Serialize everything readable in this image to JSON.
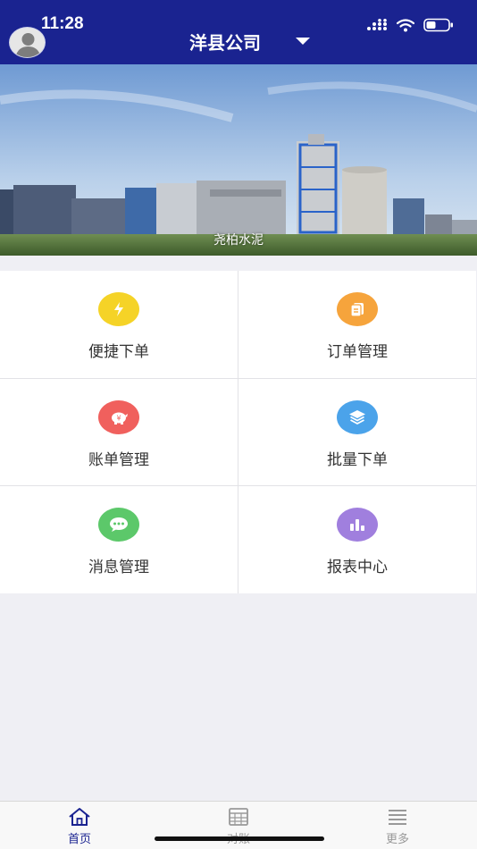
{
  "status_bar": {
    "time": "11:28"
  },
  "header": {
    "title": "洋县公司"
  },
  "banner": {
    "caption": "尧柏水泥"
  },
  "menu": {
    "items": [
      {
        "label": "便捷下单",
        "icon": "lightning-icon",
        "color": "#f5d327"
      },
      {
        "label": "订单管理",
        "icon": "document-icon",
        "color": "#f6a43c"
      },
      {
        "label": "账单管理",
        "icon": "piggy-bank-icon",
        "color": "#f0605d"
      },
      {
        "label": "批量下单",
        "icon": "layers-icon",
        "color": "#4ba3ea"
      },
      {
        "label": "消息管理",
        "icon": "chat-bubble-icon",
        "color": "#5cc86a"
      },
      {
        "label": "报表中心",
        "icon": "bar-chart-icon",
        "color": "#a07fde"
      }
    ]
  },
  "tabbar": {
    "tabs": [
      {
        "label": "首页",
        "icon": "home-icon",
        "active": true
      },
      {
        "label": "对账",
        "icon": "ledger-icon",
        "active": false
      },
      {
        "label": "更多",
        "icon": "list-icon",
        "active": false
      }
    ]
  },
  "colors": {
    "header_bg": "#1a2390",
    "page_bg": "#efeff4",
    "active_tab": "#1a2390"
  }
}
